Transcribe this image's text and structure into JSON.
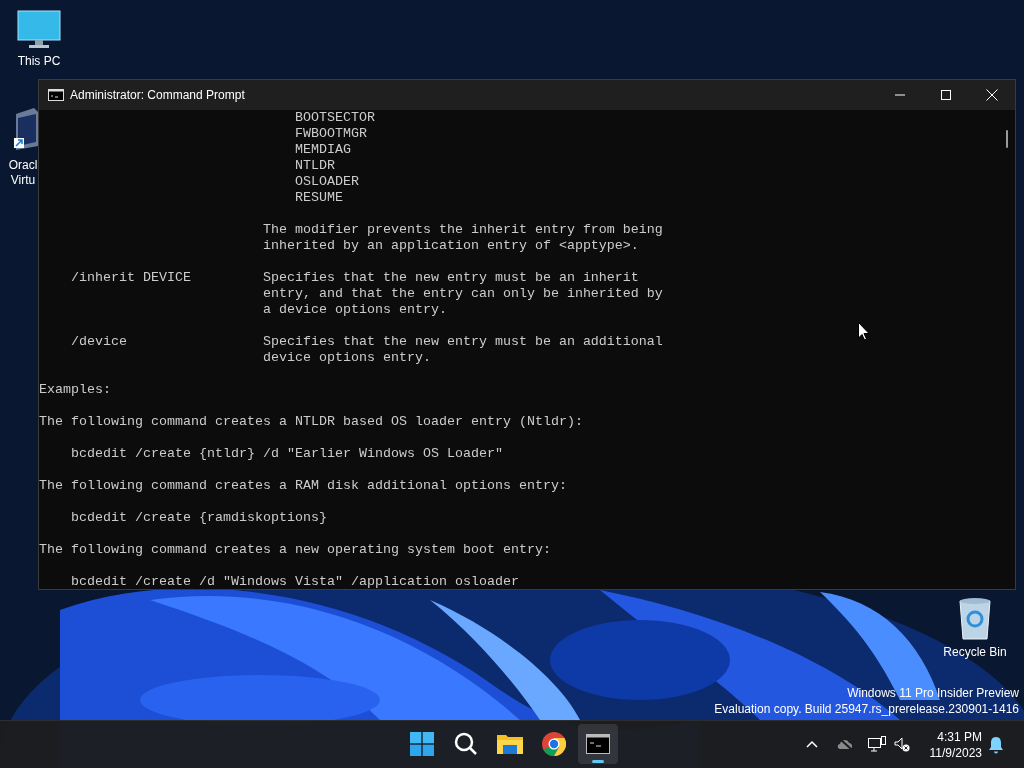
{
  "desktop_icons": [
    {
      "kind": "pc",
      "label_lines": [
        "This PC"
      ]
    },
    {
      "kind": "vbox",
      "label_lines": [
        "Oracl",
        "Virtu"
      ]
    },
    {
      "kind": "bin",
      "label_lines": [
        "Recycle Bin"
      ]
    }
  ],
  "window": {
    "title": "Administrator: Command Prompt"
  },
  "console": {
    "paragraphs": [
      [
        "                                BOOTSECTOR",
        "                                FWBOOTMGR",
        "                                MEMDIAG",
        "                                NTLDR",
        "                                OSLOADER",
        "                                RESUME"
      ],
      [
        "                            The modifier prevents the inherit entry from being",
        "                            inherited by an application entry of <apptype>."
      ],
      [
        "    /inherit DEVICE         Specifies that the new entry must be an inherit",
        "                            entry, and that the entry can only be inherited by",
        "                            a device options entry."
      ],
      [
        "    /device                 Specifies that the new entry must be an additional",
        "                            device options entry."
      ],
      [
        "Examples:"
      ],
      [
        "The following command creates a NTLDR based OS loader entry (Ntldr):"
      ],
      [
        "    bcdedit /create {ntldr} /d \"Earlier Windows OS Loader\""
      ],
      [
        "The following command creates a RAM disk additional options entry:"
      ],
      [
        "    bcdedit /create {ramdiskoptions}"
      ],
      [
        "The following command creates a new operating system boot entry:"
      ],
      [
        "    bcdedit /create /d \"Windows Vista\" /application osloader"
      ]
    ]
  },
  "watermark": [
    "Windows 11 Pro Insider Preview",
    "Evaluation copy. Build 25947.rs_prerelease.230901-1416"
  ],
  "taskbar": {
    "apps": [
      {
        "kind": "start",
        "selected": false
      },
      {
        "kind": "search",
        "selected": false
      },
      {
        "kind": "files",
        "selected": false
      },
      {
        "kind": "browser",
        "selected": false
      },
      {
        "kind": "terminal",
        "selected": true
      }
    ],
    "tray": {
      "time": "4:31 PM",
      "date": "11/9/2023"
    }
  }
}
